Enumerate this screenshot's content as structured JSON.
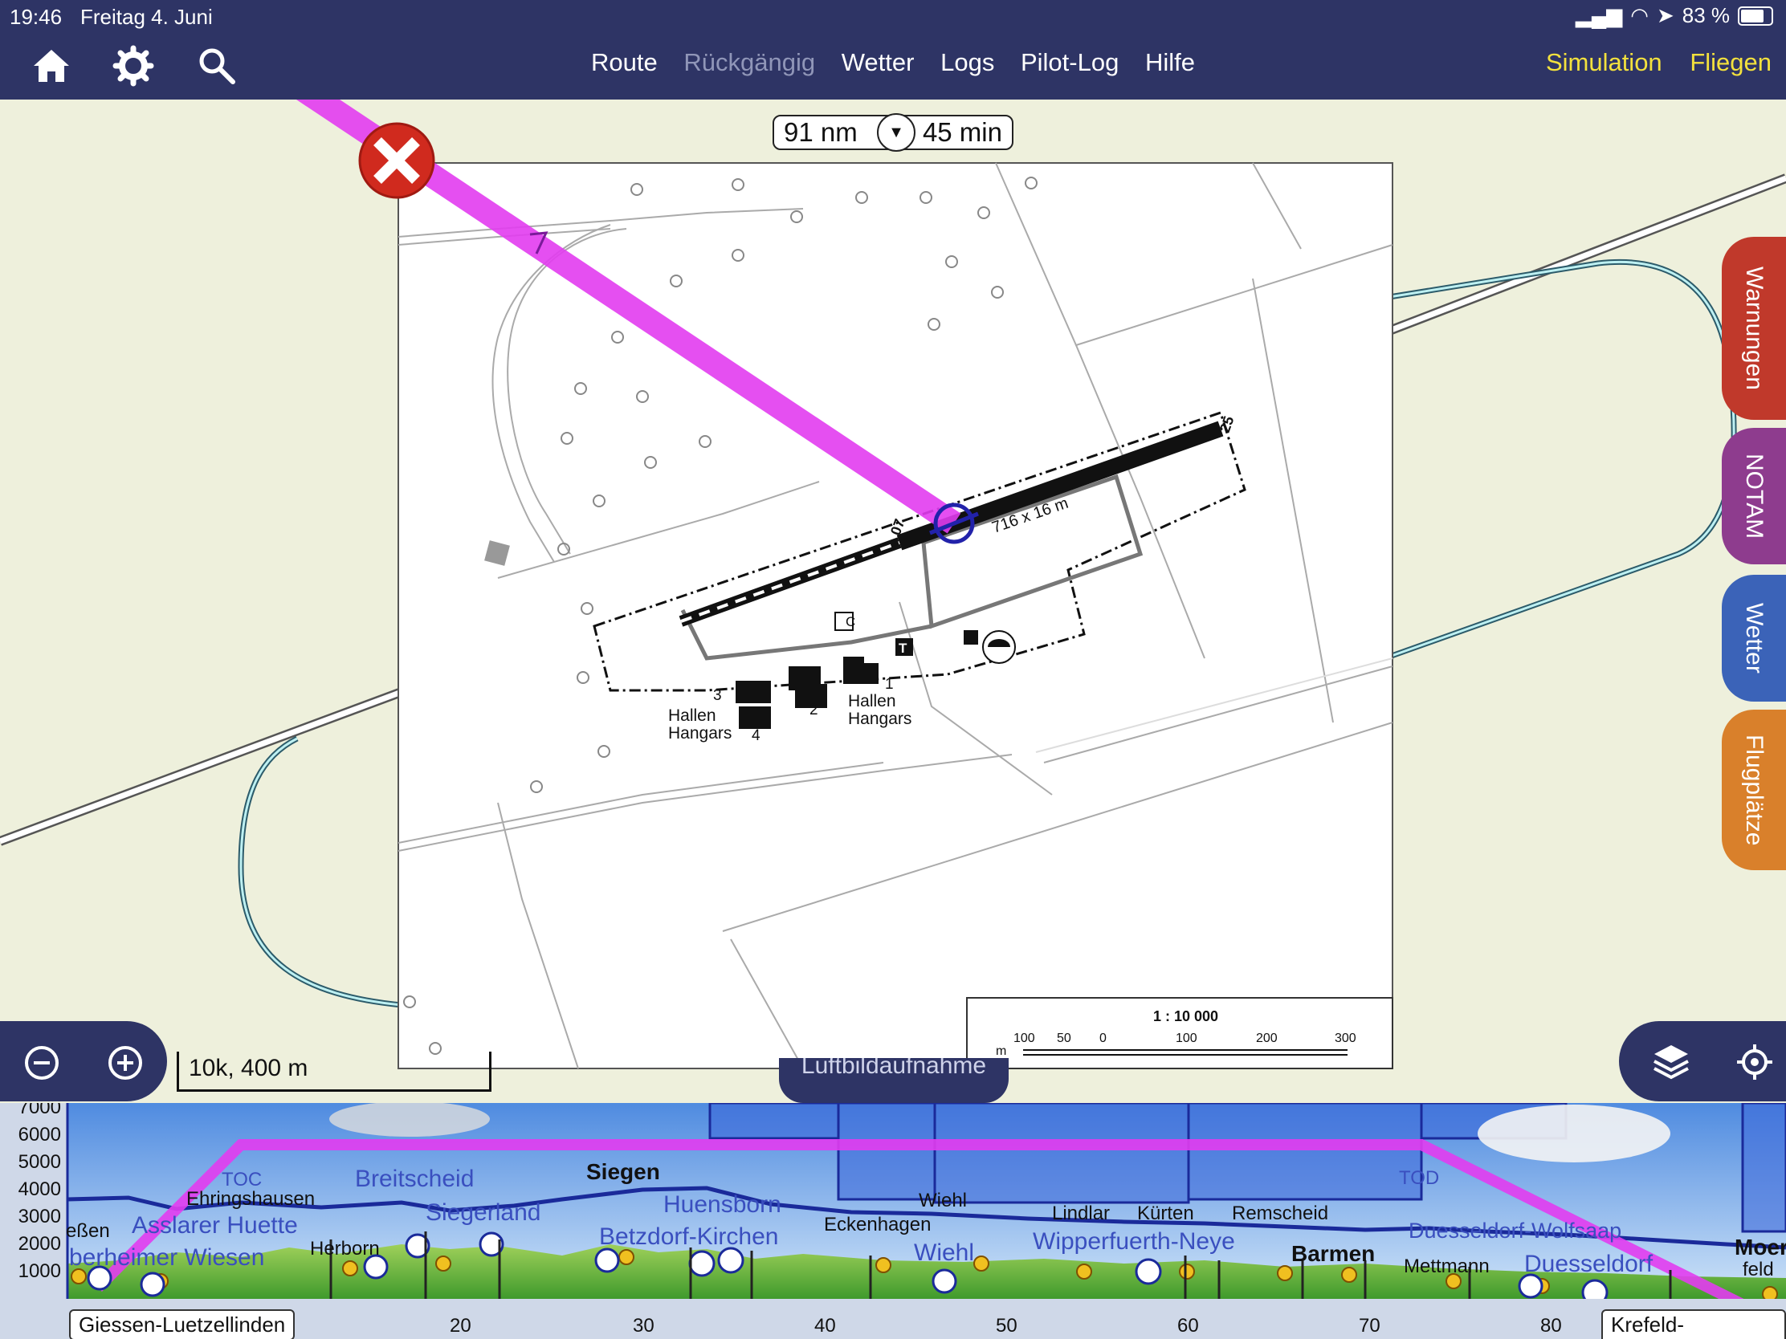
{
  "status": {
    "time": "19:46",
    "date": "Freitag 4. Juni",
    "battery": "83 %"
  },
  "nav": {
    "icons": [
      "home-icon",
      "gear-icon",
      "search-icon"
    ],
    "items": [
      {
        "label": "Route",
        "enabled": true
      },
      {
        "label": "Rückgängig",
        "enabled": false
      },
      {
        "label": "Wetter",
        "enabled": true
      },
      {
        "label": "Logs",
        "enabled": true
      },
      {
        "label": "Pilot-Log",
        "enabled": true
      },
      {
        "label": "Hilfe",
        "enabled": true
      }
    ],
    "right": [
      "Simulation",
      "Fliegen"
    ],
    "right_color": "#f3e13d"
  },
  "route_info": {
    "distance": "91 nm",
    "time": "45 min"
  },
  "chart": {
    "runway_label": "716 x 16 m",
    "rwy_left": "07",
    "rwy_right": "25",
    "hangar_labels": [
      "Hallen",
      "Hangars"
    ],
    "hangar_numbers": [
      "1",
      "2",
      "3",
      "4"
    ],
    "scale_ratio": "1 : 10 000",
    "scale_ticks": [
      "100",
      "50",
      "0",
      "100",
      "200",
      "300"
    ],
    "scale_unit": "m",
    "symbol_c": "C",
    "symbol_t": "T"
  },
  "side_tabs": [
    {
      "label": "Warnungen",
      "color": "#c0392b"
    },
    {
      "label": "NOTAM",
      "color": "#8e3c8e"
    },
    {
      "label": "Wetter",
      "color": "#3b63b8"
    },
    {
      "label": "Flugplätze",
      "color": "#d9802b"
    }
  ],
  "map_scale": "10k, 400 m",
  "hidden_button": "Luftbildaufnahme",
  "profile": {
    "y_ticks": [
      "7000",
      "6000",
      "5000",
      "4000",
      "3000",
      "2000",
      "1000"
    ],
    "x_ticks": [
      "20",
      "30",
      "40",
      "50",
      "60",
      "70",
      "80"
    ],
    "start_wp": "Giessen-Luetzellinden",
    "end_wp": "Krefeld-Egelsberg",
    "labels_black": [
      "eßen",
      "Ehringshausen",
      "Herborn",
      "Wiehl",
      "Eckenhagen",
      "Lindlar",
      "Kürten",
      "Remscheid",
      "Mettmann",
      "TOC",
      "TOD",
      "feld"
    ],
    "labels_blue": [
      "Asslarer Huette",
      "berheimer Wiesen",
      "Breitscheid",
      "Siegerland",
      "Huensborn",
      "Betzdorf-Kirchen",
      "Wiehl",
      "Wipperfuerth-Neye",
      "Duesseldorf-Wolfsaap",
      "Duesseldorf"
    ],
    "labels_bold": [
      "Siegen",
      "Barmen",
      "Moer"
    ]
  }
}
